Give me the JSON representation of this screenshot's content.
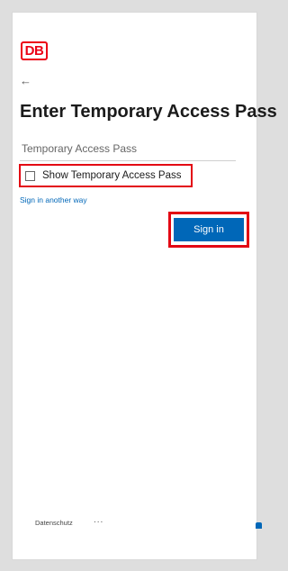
{
  "logo": {
    "text": "DB"
  },
  "back": {
    "icon": "back-arrow-icon",
    "glyph": "←"
  },
  "title": "Enter Temporary Access Pass",
  "input": {
    "placeholder": "Temporary Access Pass",
    "value": ""
  },
  "show_checkbox": {
    "label": "Show Temporary Access Pass",
    "checked": false
  },
  "alt_link": "Sign in another way",
  "sign_in_button": "Sign in",
  "footer": {
    "privacy_link": "Datenschutz",
    "more": "..."
  },
  "colors": {
    "brand_red": "#ec0016",
    "highlight_red": "#e30613",
    "accent_blue": "#0067b8"
  }
}
